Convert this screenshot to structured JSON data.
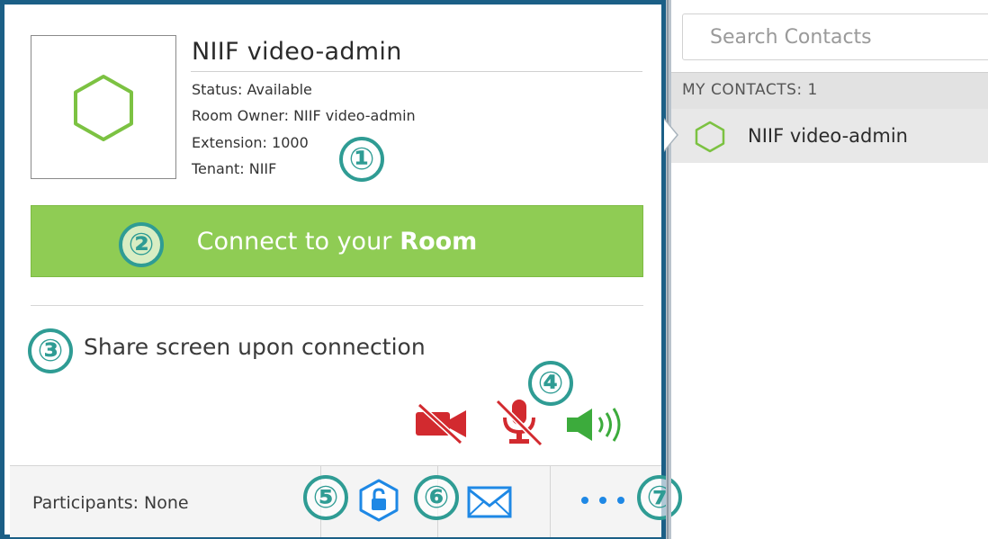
{
  "room": {
    "name": "NIIF video-admin",
    "status": "Status: Available",
    "room_owner": "Room Owner: NIIF video-admin",
    "extension": "Extension: 1000",
    "tenant": "Tenant: NIIF",
    "status_color": "#7cc242"
  },
  "connect": {
    "prefix": "Connect to your",
    "room_word": "Room",
    "color": "#8fcc54"
  },
  "share_screen": "Share screen upon connection",
  "controls": {
    "camera_icon": "camera-off-icon",
    "mic_icon": "mic-muted-icon",
    "speaker_icon": "speaker-on-icon",
    "muted_color": "#d22a2f",
    "speaker_color": "#3cab3c"
  },
  "footer": {
    "participants": "Participants: None",
    "lock_icon": "lock-room-icon",
    "email_icon": "email-invite-icon",
    "more_icon": "more-options-icon",
    "accent": "#1e88e5"
  },
  "callouts": [
    "①",
    "②",
    "③",
    "④",
    "⑤",
    "⑥",
    "⑦"
  ],
  "contacts": {
    "search_placeholder": "Search Contacts",
    "header": "MY CONTACTS: 1",
    "items": [
      {
        "name": "NIIF video-admin",
        "status": "available"
      }
    ]
  }
}
